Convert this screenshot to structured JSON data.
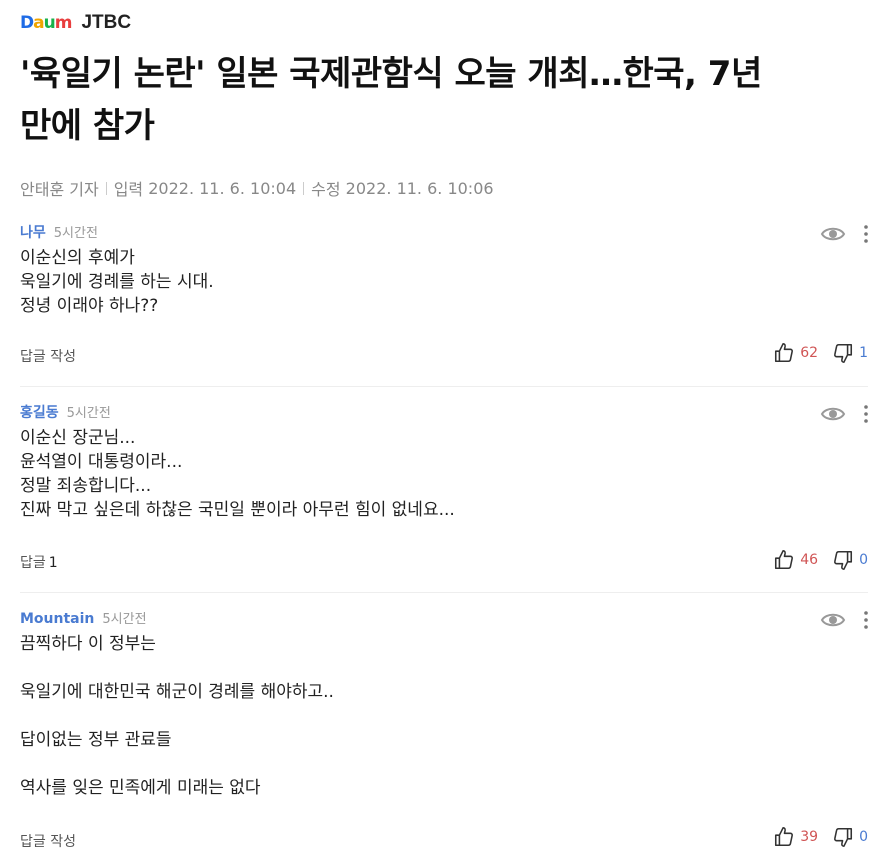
{
  "header": {
    "logo_letters": [
      "D",
      "a",
      "u",
      "m"
    ],
    "logo_colors": [
      "#1e6be6",
      "#f0a500",
      "#19b14a",
      "#e83e3e"
    ],
    "press": "JTBC"
  },
  "article": {
    "title_line1": "'육일기 논란' 일본 국제관함식 오늘 개최…한국, 7년",
    "title_line2": "만에 참가",
    "reporter": "안태훈 기자",
    "input_label": "입력",
    "input_time": "2022. 11. 6. 10:04",
    "modified_label": "수정",
    "modified_time": "2022. 11. 6. 10:06"
  },
  "comments": [
    {
      "author": "나무",
      "time": "5시간전",
      "lines": [
        "이순신의 후예가",
        "욱일기에 경례를 하는 시대.",
        "정녕 이래야 하나??"
      ],
      "reply_label": "답글 작성",
      "reply_count": "",
      "likes": "62",
      "dislikes": "1"
    },
    {
      "author": "홍길동",
      "time": "5시간전",
      "lines": [
        "이순신 장군님...",
        "윤석열이 대통령이라...",
        "정말 죄송합니다...",
        "진짜 막고 싶은데 하찮은 국민일 뿐이라 아무런 힘이 없네요..."
      ],
      "reply_label": "답글",
      "reply_count": "1",
      "likes": "46",
      "dislikes": "0"
    },
    {
      "author": "Mountain",
      "time": "5시간전",
      "lines": [
        "끔찍하다 이 정부는",
        "",
        "욱일기에 대한민국 해군이 경례를 해야하고..",
        "",
        "답이없는 정부 관료들",
        "",
        "역사를 잊은 민족에게 미래는 없다"
      ],
      "reply_label": "답글 작성",
      "reply_count": "",
      "likes": "39",
      "dislikes": "0"
    }
  ],
  "icons": {
    "view": "eye-icon",
    "more": "more-vertical-icon",
    "like": "thumbs-up-icon",
    "dislike": "thumbs-down-icon"
  }
}
